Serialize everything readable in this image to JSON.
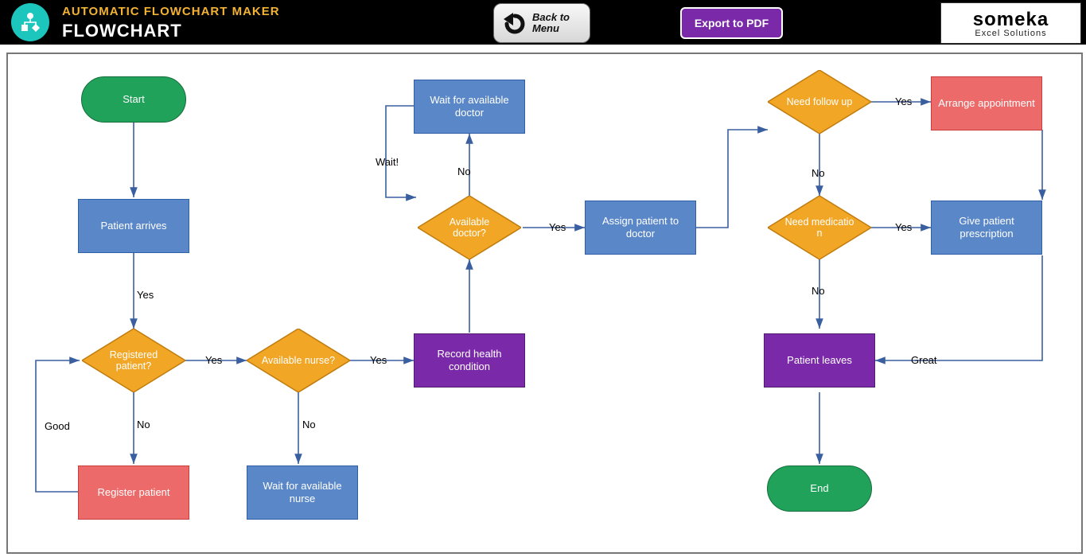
{
  "header": {
    "subtitle": "AUTOMATIC FLOWCHART MAKER",
    "title": "FLOWCHART",
    "back_line1": "Back to",
    "back_line2": "Menu",
    "export_label": "Export to PDF",
    "brand_name": "someka",
    "brand_tag": "Excel Solutions"
  },
  "nodes": {
    "start": "Start",
    "patient_arrives": "Patient arrives",
    "registered_patient": "Registered patient?",
    "register_patient": "Register patient",
    "available_nurse": "Available nurse?",
    "wait_nurse": "Wait for available nurse",
    "record_health": "Record health condition",
    "available_doctor": "Available doctor?",
    "wait_doctor": "Wait for available doctor",
    "assign_doctor": "Assign patient to doctor",
    "need_followup": "Need follow up",
    "arrange_appt": "Arrange appointment",
    "need_medication": "Need medicatio\nn",
    "give_prescription": "Give patient prescription",
    "patient_leaves": "Patient leaves",
    "end": "End"
  },
  "labels": {
    "yes": "Yes",
    "no": "No",
    "wait": "Wait!",
    "good": "Good",
    "great": "Great"
  },
  "chart_data": {
    "type": "flowchart",
    "nodes": [
      {
        "id": "start",
        "kind": "terminator",
        "label": "Start"
      },
      {
        "id": "patient_arrives",
        "kind": "process",
        "label": "Patient arrives"
      },
      {
        "id": "registered_patient",
        "kind": "decision",
        "label": "Registered patient?"
      },
      {
        "id": "register_patient",
        "kind": "process",
        "label": "Register patient"
      },
      {
        "id": "available_nurse",
        "kind": "decision",
        "label": "Available nurse?"
      },
      {
        "id": "wait_nurse",
        "kind": "process",
        "label": "Wait for available nurse"
      },
      {
        "id": "record_health",
        "kind": "process",
        "label": "Record health condition"
      },
      {
        "id": "available_doctor",
        "kind": "decision",
        "label": "Available doctor?"
      },
      {
        "id": "wait_doctor",
        "kind": "process",
        "label": "Wait for available doctor"
      },
      {
        "id": "assign_doctor",
        "kind": "process",
        "label": "Assign patient to doctor"
      },
      {
        "id": "need_followup",
        "kind": "decision",
        "label": "Need follow up"
      },
      {
        "id": "arrange_appt",
        "kind": "process",
        "label": "Arrange appointment"
      },
      {
        "id": "need_medication",
        "kind": "decision",
        "label": "Need medication"
      },
      {
        "id": "give_prescription",
        "kind": "process",
        "label": "Give patient prescription"
      },
      {
        "id": "patient_leaves",
        "kind": "process",
        "label": "Patient leaves"
      },
      {
        "id": "end",
        "kind": "terminator",
        "label": "End"
      }
    ],
    "edges": [
      {
        "from": "start",
        "to": "patient_arrives"
      },
      {
        "from": "patient_arrives",
        "to": "registered_patient",
        "label": "Yes"
      },
      {
        "from": "registered_patient",
        "to": "register_patient",
        "label": "No"
      },
      {
        "from": "register_patient",
        "to": "registered_patient",
        "label": "Good"
      },
      {
        "from": "registered_patient",
        "to": "available_nurse",
        "label": "Yes"
      },
      {
        "from": "available_nurse",
        "to": "wait_nurse",
        "label": "No"
      },
      {
        "from": "available_nurse",
        "to": "record_health",
        "label": "Yes"
      },
      {
        "from": "record_health",
        "to": "available_doctor"
      },
      {
        "from": "available_doctor",
        "to": "wait_doctor",
        "label": "No"
      },
      {
        "from": "wait_doctor",
        "to": "available_doctor",
        "label": "Wait!"
      },
      {
        "from": "available_doctor",
        "to": "assign_doctor",
        "label": "Yes"
      },
      {
        "from": "assign_doctor",
        "to": "need_followup"
      },
      {
        "from": "need_followup",
        "to": "arrange_appt",
        "label": "Yes"
      },
      {
        "from": "need_followup",
        "to": "need_medication",
        "label": "No"
      },
      {
        "from": "need_medication",
        "to": "give_prescription",
        "label": "Yes"
      },
      {
        "from": "need_medication",
        "to": "patient_leaves",
        "label": "No"
      },
      {
        "from": "give_prescription",
        "to": "patient_leaves",
        "label": "Great"
      },
      {
        "from": "arrange_appt",
        "to": "give_prescription"
      },
      {
        "from": "patient_leaves",
        "to": "end"
      }
    ]
  }
}
